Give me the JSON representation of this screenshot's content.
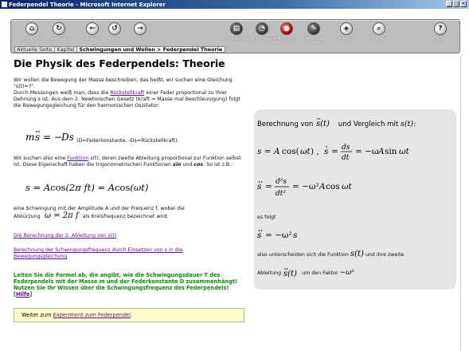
{
  "window": {
    "title": "Federpendel Theorie - Microsoft Internet Explorer",
    "controls": [
      "_",
      "□",
      "×"
    ]
  },
  "toolbar": {
    "items": [
      {
        "label": "pm² Portal",
        "icon": "home-icon",
        "glyph": "⌂"
      },
      {
        "label": "Startseite",
        "icon": "refresh-icon",
        "glyph": "↻"
      },
      {
        "label": "Zurück",
        "icon": "back-arrow-icon",
        "glyph": "←"
      },
      {
        "label": "Historie",
        "icon": "history-icon",
        "glyph": "↺"
      },
      {
        "label": "Vorwärts",
        "icon": "forward-arrow-icon",
        "glyph": "→"
      },
      {
        "label": "Coursemap",
        "icon": "coursemap-icon",
        "glyph": "▤"
      },
      {
        "label": "Kommunikation",
        "icon": "communication-icon",
        "glyph": "◔"
      },
      {
        "label": "Mein pm²",
        "icon": "my-pm2-icon",
        "glyph": "●"
      },
      {
        "label": "Werkzeuge",
        "icon": "tools-icon",
        "glyph": "✎"
      },
      {
        "label": "Drucken",
        "icon": "print-icon",
        "glyph": "◈"
      },
      {
        "label": "Suchen",
        "icon": "search-icon",
        "glyph": "⌕"
      },
      {
        "label": "Hilfe",
        "icon": "help-icon",
        "glyph": "?"
      }
    ],
    "crumb_label": "Aktuelle Seite / Kapitel",
    "crumb_value": "Schwingungen und Wellen > Federpendel Theorie"
  },
  "page": {
    "title": "Die Physik des Federpendels: Theorie",
    "intro_1": "Wir wollen die Bewegung der Masse beschreiben, das heißt, wir suchen eine Gleichung \"s(t)=?\".",
    "intro_2_pre": "Durch Messungen weiß man, dass die ",
    "intro_2_link": "Rückstellkraft",
    "intro_2_post": " einer Feder proportional zu ihrer Dehnung s ist. Aus dem 2. Newtonschen Gesetz (Kraft = Masse mal Beschleunigung) folgt die Bewegungsgleichung für den harmonischen Oszillator:",
    "eq1_note": "(D=Federkonstante, -Ds=Rückstellkraft).",
    "para2_pre": "Wir suchen also eine ",
    "para2_link": "Funktion",
    "para2_mid": " s(t), deren zweite Ableitung proportional zur Funktion selbst ist. Diese Eigenschaft haben die trigonometrischen Funktionen ",
    "para2_sin": "sin",
    "para2_und": " und ",
    "para2_cos": "cos",
    "para2_post": ". So ist z.B.:",
    "para3": "eine Schwingung mit der Amplitude A und der Frequenz f, wobei die",
    "para3_abbr": "Abkürzung",
    "para3_post": "als Kreisfrequenz bezeichnet wird.",
    "link_derivative": "Die Berechnung der 2. Ableitung von s(t)",
    "link_frequency": "Berechnung der Schwingungsfrequenz durch Einsetzen von s in die Bewegungsgleichung",
    "task_text": "Leiten Sie die Formel ab, die angibt, wie die Schwingungsdauer T des Federpendels mit der Masse m und der Federkonstante D zusammenhängt! Nutzen Sie Ihr Wissen über die Schwingungsfrequenz des Federpendels! [",
    "task_link": "Hilfe",
    "task_close": "]",
    "next_pre": "Weiter zum ",
    "next_link": "Experiment zum Federpendel",
    "next_post": "."
  },
  "panel": {
    "heading_pre": "Berechnung von",
    "heading_mid": "und Vergleich mit",
    "es_folgt": "es folgt",
    "also_line": "also unterscheiden sich die Funktion",
    "also_line_post": "und ihre zweite",
    "ableitung": "Ableitung",
    "um_den": "um den Faktor"
  }
}
